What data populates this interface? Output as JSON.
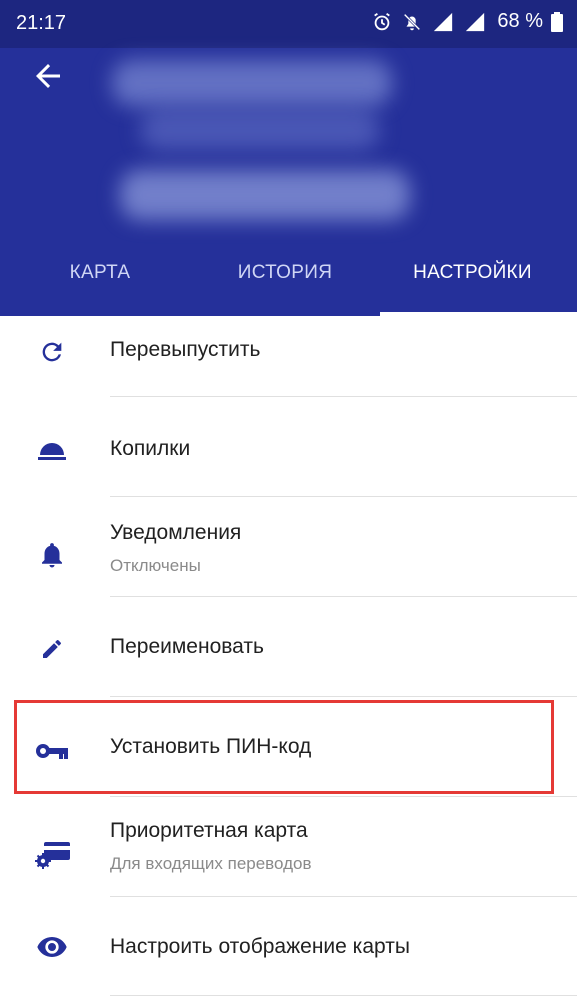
{
  "status_bar": {
    "time": "21:17",
    "battery": "68 %"
  },
  "tabs": [
    {
      "label": "КАРТА",
      "active": false
    },
    {
      "label": "ИСТОРИЯ",
      "active": false
    },
    {
      "label": "НАСТРОЙКИ",
      "active": true
    }
  ],
  "settings": [
    {
      "title": "Перевыпустить",
      "icon": "refresh-icon"
    },
    {
      "title": "Копилки",
      "icon": "piggy-bank-icon"
    },
    {
      "title": "Уведомления",
      "subtitle": "Отключены",
      "icon": "bell-icon"
    },
    {
      "title": "Переименовать",
      "icon": "pencil-icon"
    },
    {
      "title": "Установить ПИН-код",
      "icon": "key-icon"
    },
    {
      "title": "Приоритетная карта",
      "subtitle": "Для входящих переводов",
      "icon": "card-gear-icon"
    },
    {
      "title": "Настроить отображение карты",
      "icon": "eye-icon"
    }
  ],
  "colors": {
    "header": "#25309a",
    "status_bar": "#1d2680",
    "icon": "#25309a",
    "highlight": "#e53935"
  }
}
